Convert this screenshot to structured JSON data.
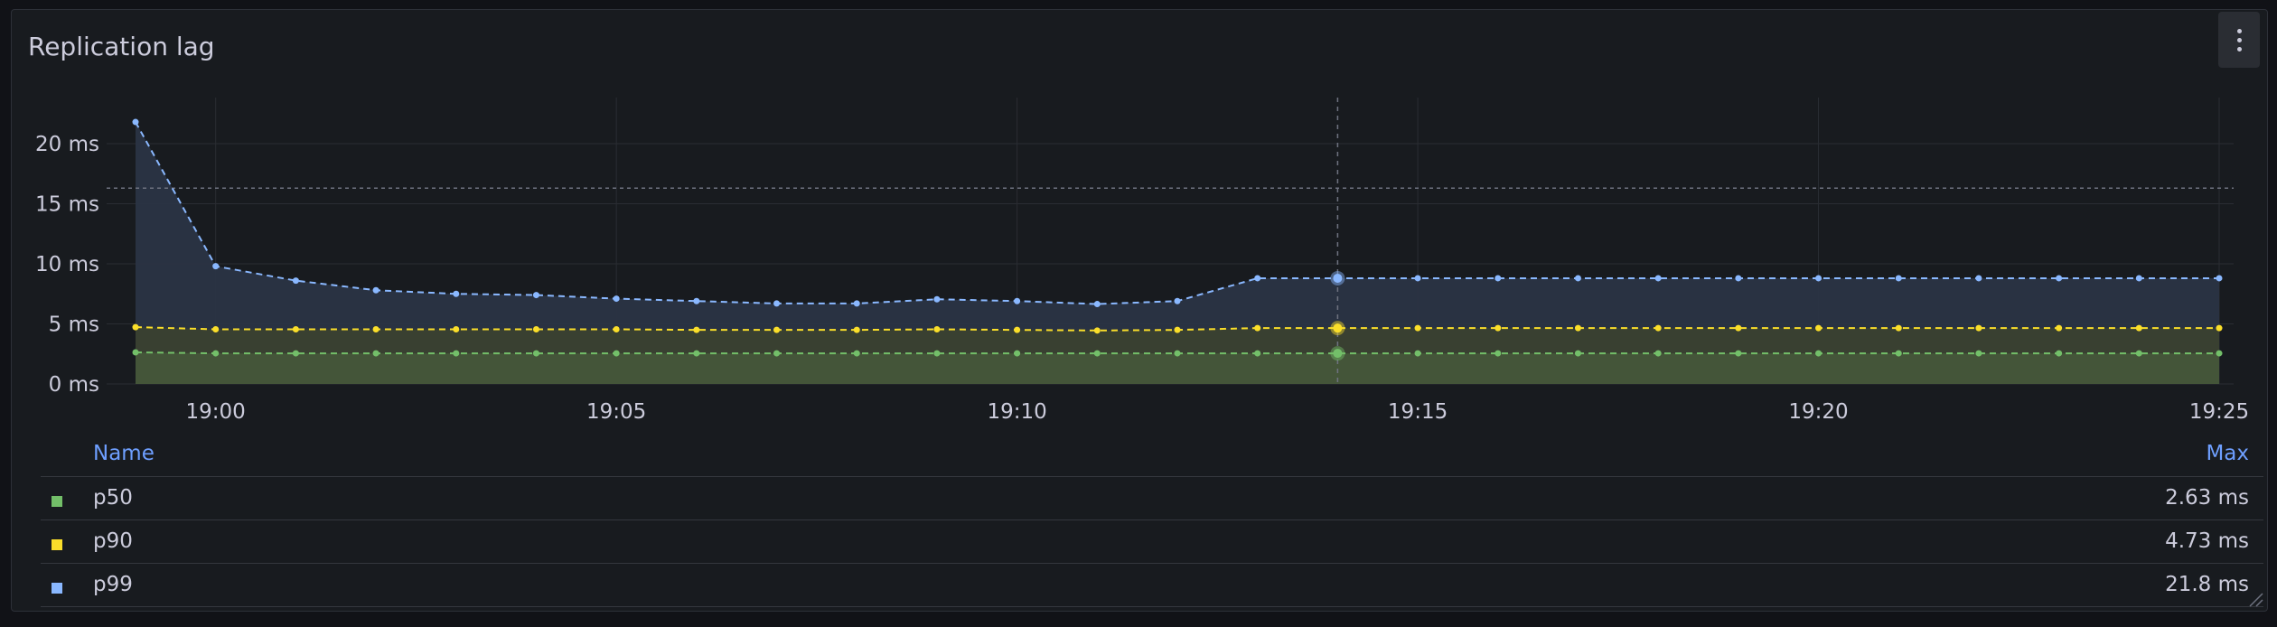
{
  "panel": {
    "title": "Replication lag",
    "menu_icon": "vertical-ellipsis-icon"
  },
  "colors": {
    "p50": "#73bf69",
    "p90": "#fade2a",
    "p99": "#8ab8ff",
    "threshold": "#6e7280"
  },
  "chart_data": {
    "type": "line",
    "x": [
      "18:59",
      "19:00",
      "19:01",
      "19:02",
      "19:03",
      "19:04",
      "19:05",
      "19:06",
      "19:07",
      "19:08",
      "19:09",
      "19:10",
      "19:11",
      "19:12",
      "19:13",
      "19:14",
      "19:15",
      "19:16",
      "19:17",
      "19:18",
      "19:19",
      "19:20",
      "19:21",
      "19:22",
      "19:23",
      "19:24",
      "19:25"
    ],
    "xticks": [
      "19:00",
      "19:05",
      "19:10",
      "19:15",
      "19:20",
      "19:25"
    ],
    "yticks": [
      "0 ms",
      "5 ms",
      "10 ms",
      "15 ms",
      "20 ms"
    ],
    "ylim": [
      0,
      24
    ],
    "threshold": 16.3,
    "hover_x": "19:14",
    "grid": true,
    "legend_placement": "bottom",
    "series": [
      {
        "name": "p50",
        "values": [
          2.63,
          2.55,
          2.55,
          2.55,
          2.55,
          2.55,
          2.55,
          2.55,
          2.55,
          2.55,
          2.55,
          2.55,
          2.55,
          2.55,
          2.55,
          2.55,
          2.55,
          2.55,
          2.55,
          2.55,
          2.55,
          2.55,
          2.55,
          2.55,
          2.55,
          2.55,
          2.55
        ]
      },
      {
        "name": "p90",
        "values": [
          4.73,
          4.55,
          4.55,
          4.55,
          4.55,
          4.55,
          4.55,
          4.5,
          4.5,
          4.5,
          4.55,
          4.5,
          4.45,
          4.5,
          4.65,
          4.65,
          4.65,
          4.65,
          4.65,
          4.65,
          4.65,
          4.65,
          4.65,
          4.65,
          4.65,
          4.65,
          4.65
        ]
      },
      {
        "name": "p99",
        "values": [
          21.8,
          9.8,
          8.6,
          7.8,
          7.5,
          7.4,
          7.1,
          6.9,
          6.7,
          6.7,
          7.05,
          6.9,
          6.65,
          6.9,
          8.8,
          8.8,
          8.8,
          8.8,
          8.8,
          8.8,
          8.8,
          8.8,
          8.8,
          8.8,
          8.8,
          8.8,
          8.8
        ]
      }
    ]
  },
  "legend": {
    "name_header": "Name",
    "max_header": "Max",
    "rows": [
      {
        "name": "p50",
        "max": "2.63 ms"
      },
      {
        "name": "p90",
        "max": "4.73 ms"
      },
      {
        "name": "p99",
        "max": "21.8 ms"
      }
    ]
  }
}
